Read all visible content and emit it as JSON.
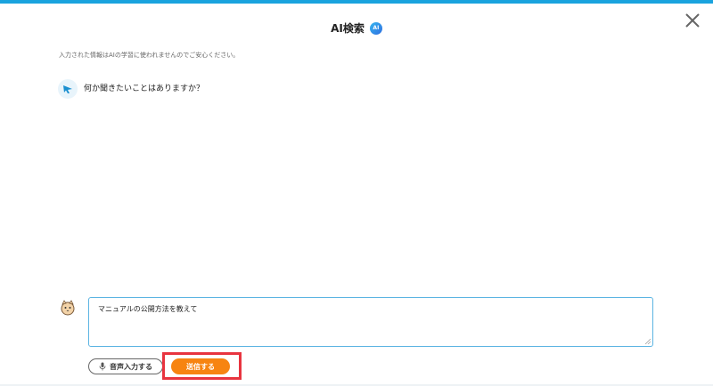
{
  "header": {
    "title": "AI検索",
    "badge": "AI"
  },
  "notice": "入力された情報はAIの学習に使われませんのでご安心ください。",
  "chat": {
    "bot_message": "何か聞きたいことはありますか？"
  },
  "input": {
    "value": "マニュアルの公開方法を教えて"
  },
  "actions": {
    "voice_label": "音声入力する",
    "send_label": "送信する"
  },
  "colors": {
    "accent": "#1aa3de",
    "send": "#f78411",
    "highlight": "#e8343f"
  },
  "icons": {
    "close": "close-icon",
    "bot": "bird-icon",
    "user": "cat-avatar-icon",
    "mic": "microphone-icon"
  }
}
